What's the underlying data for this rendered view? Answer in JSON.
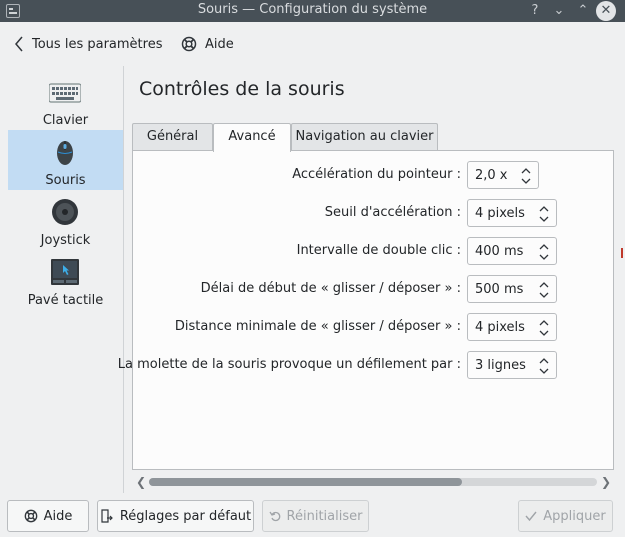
{
  "window": {
    "title": "Souris — Configuration du système",
    "controls": [
      "?",
      "⌄",
      "⌃",
      "✕"
    ]
  },
  "toolbar": {
    "back_label": "Tous les paramètres",
    "help_label": "Aide"
  },
  "sidebar": {
    "items": [
      {
        "label": "Clavier",
        "icon": "keyboard-icon",
        "selected": false
      },
      {
        "label": "Souris",
        "icon": "mouse-icon",
        "selected": true
      },
      {
        "label": "Joystick",
        "icon": "joystick-icon",
        "selected": false
      },
      {
        "label": "Pavé tactile",
        "icon": "touchpad-icon",
        "selected": false
      }
    ]
  },
  "main": {
    "title": "Contrôles de la souris",
    "tabs": [
      {
        "label": "Général",
        "active": false
      },
      {
        "label": "Avancé",
        "active": true
      },
      {
        "label": "Navigation au clavier",
        "active": false
      }
    ],
    "settings": [
      {
        "label": "Accélération du pointeur :",
        "value": "2,0 x"
      },
      {
        "label": "Seuil d'accélération :",
        "value": "4 pixels"
      },
      {
        "label": "Intervalle de double clic :",
        "value": "400 ms"
      },
      {
        "label": "Délai de début de « glisser / déposer » :",
        "value": "500 ms"
      },
      {
        "label": "Distance minimale de « glisser / déposer » :",
        "value": "4 pixels"
      },
      {
        "label": "La molette de la souris provoque un défilement par :",
        "value": "3 lignes"
      }
    ]
  },
  "buttons": {
    "help": "Aide",
    "defaults": "Réglages par défaut",
    "reset": "Réinitialiser",
    "apply": "Appliquer"
  },
  "colors": {
    "titlebar": "#475057",
    "selection": "#c2dcf3",
    "background": "#eff0f1"
  }
}
